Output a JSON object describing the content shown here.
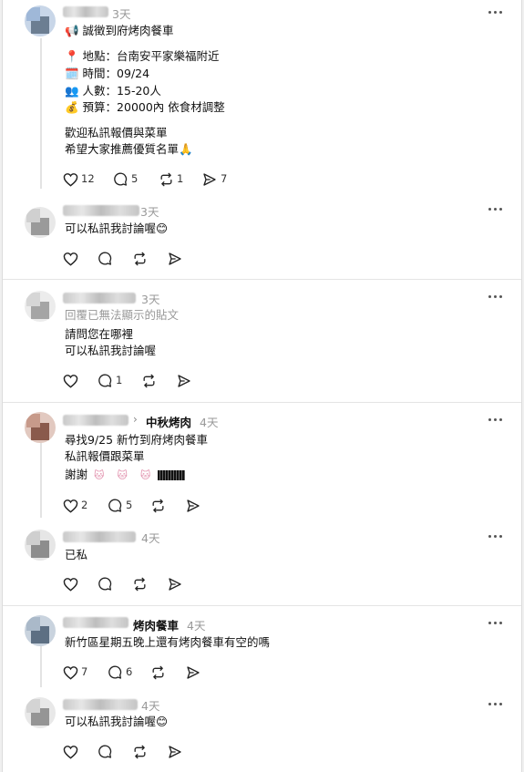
{
  "posts": [
    {
      "time": "3天",
      "lines": [
        "📢 誠徵到府烤肉餐車",
        "📍 地點：台南安平家樂福附近",
        "🗓️ 時間：09/24",
        "👥 人數：15-20人",
        "💰 預算：20000內 依食材調整",
        "歡迎私訊報價與菜單",
        "希望大家推薦優質名單🙏"
      ],
      "likes": "12",
      "replies": "5",
      "reposts": "1",
      "shares": "7"
    },
    {
      "time": "3天",
      "lines": [
        "可以私訊我討論喔😊"
      ],
      "likes": "",
      "replies": "",
      "reposts": "",
      "shares": ""
    },
    {
      "time": "3天",
      "note": "回覆已無法顯示的貼文",
      "lines": [
        "請問您在哪裡",
        "可以私訊我討論喔"
      ],
      "likes": "",
      "replies": "1",
      "reposts": "",
      "shares": ""
    },
    {
      "time": "4天",
      "separator": "›",
      "tag": "中秋烤肉",
      "lines": [
        "尋找9/25 新竹到府烤肉餐車",
        "私訊報價跟菜單",
        "謝謝"
      ],
      "likes": "2",
      "replies": "5",
      "reposts": "",
      "shares": ""
    },
    {
      "time": "4天",
      "lines": [
        "已私"
      ],
      "likes": "",
      "replies": "",
      "reposts": "",
      "shares": ""
    },
    {
      "time": "4天",
      "tag": "烤肉餐車",
      "lines": [
        "新竹區星期五晚上還有烤肉餐車有空的嗎"
      ],
      "likes": "7",
      "replies": "6",
      "reposts": "",
      "shares": ""
    },
    {
      "time": "4天",
      "lines": [
        "可以私訊我討論喔😊"
      ],
      "likes": "",
      "replies": "",
      "reposts": "",
      "shares": ""
    }
  ],
  "icons": {
    "like": "heart-icon",
    "reply": "comment-icon",
    "repost": "repost-icon",
    "share": "send-icon",
    "more": "more-icon",
    "kitty": "hello-kitty-emoji"
  },
  "colors": {
    "text": "#111111",
    "muted": "#999999",
    "divider": "#e4e4e4",
    "thread": "#e3e3e3"
  }
}
